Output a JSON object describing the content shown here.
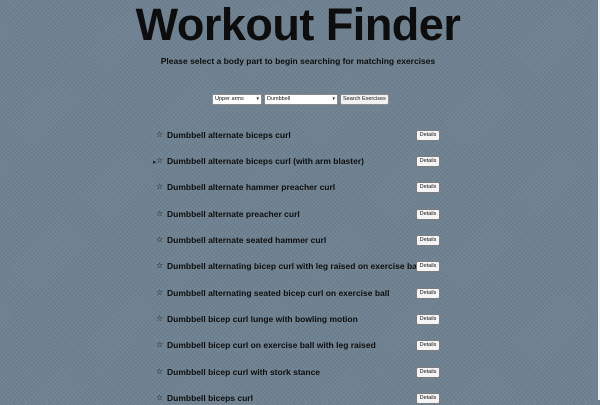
{
  "header": {
    "title": "Workout Finder",
    "subtitle": "Please select a body part to begin searching for matching exercises"
  },
  "controls": {
    "body_part_value": "Upper arms",
    "equipment_value": "Dumbbell",
    "search_label": "Search Exercises"
  },
  "results": {
    "star_glyph": "☆",
    "details_label": "Details",
    "items": [
      {
        "name": "Dumbbell alternate biceps curl"
      },
      {
        "name": "Dumbbell alternate biceps curl (with arm blaster)"
      },
      {
        "name": "Dumbbell alternate hammer preacher curl"
      },
      {
        "name": "Dumbbell alternate preacher curl"
      },
      {
        "name": "Dumbbell alternate seated hammer curl"
      },
      {
        "name": "Dumbbell alternating bicep curl with leg raised on exercise ball"
      },
      {
        "name": "Dumbbell alternating seated bicep curl on exercise ball"
      },
      {
        "name": "Dumbbell bicep curl lunge with bowling motion"
      },
      {
        "name": "Dumbbell bicep curl on exercise ball with leg raised"
      },
      {
        "name": "Dumbbell bicep curl with stork stance"
      },
      {
        "name": "Dumbbell biceps curl"
      }
    ]
  },
  "colors": {
    "background": "#6f8291",
    "text": "#0d0d0d"
  }
}
